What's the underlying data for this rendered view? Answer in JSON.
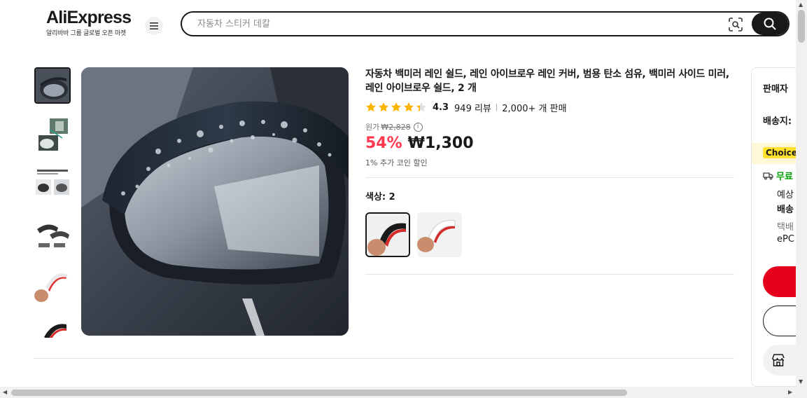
{
  "header": {
    "logo_text": "AliExpress",
    "logo_subtitle": "알리바바 그룹 글로벌 오픈 마켓",
    "menu_icon": "hamburger-menu-icon",
    "search": {
      "placeholder": "자동차 스티커 데칼",
      "value": "",
      "image_search_icon": "camera-lens-icon",
      "search_icon": "magnifier-icon"
    }
  },
  "gallery": {
    "thumbnail_count": 6,
    "selected_index": 0
  },
  "product": {
    "title": "자동차 백미러 레인 쉴드, 레인 아이브로우 레인 커버, 범용 탄소 섬유, 백미러 사이드 미러, 레인 아이브로우 쉴드, 2 개",
    "rating": "4.3",
    "rating_value": 4.3,
    "reviews": "949 리뷰",
    "sold": "2,000+ 개 판매",
    "original_price_label": "원가",
    "original_price": "₩2,828",
    "discount": "54%",
    "price": "₩1,300",
    "coin_discount": "1% 추가 코인 할인",
    "color_label": "색상: 2",
    "swatches": [
      {
        "name": "color-option-1",
        "selected": true
      },
      {
        "name": "color-option-2",
        "selected": false
      }
    ]
  },
  "side_panel": {
    "seller_label": "판매자",
    "ship_to_label": "배송지:",
    "choice_badge": "Choice",
    "free_shipping": "무료",
    "line1": "예상",
    "line2": "배송",
    "line3": "택배",
    "line4": "ePC"
  },
  "colors": {
    "accent_red": "#fd384f",
    "buy_red": "#e5001c",
    "choice_yellow": "#ffe22e",
    "free_green": "#00a000",
    "text_dark": "#191919"
  }
}
